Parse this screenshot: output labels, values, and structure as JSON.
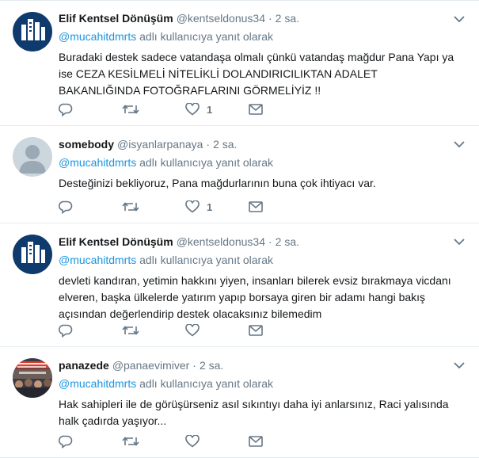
{
  "labels": {
    "reply_suffix": "adlı kullanıcıya yanıt olarak"
  },
  "colors": {
    "link": "#1b95e0",
    "meta": "#657786",
    "icon": "#657786",
    "border": "#e6ecf0"
  },
  "tweets": [
    {
      "name": "Elif Kentsel Dönüşüm",
      "handle": "@kentseldonus34",
      "time": "2 sa.",
      "avatar_icon": "elif-logo-avatar",
      "reply_to": "@mucahitdmrts",
      "text": "Buradaki destek sadece vatandaşa olmalı çünkü vatandaş mağdur Pana Yapı ya ise CEZA KESİLMELİ NİTELİKLİ DOLANDIRICILIKTAN ADALET BAKANLIĞINDA FOTOĞRAFLARINI GÖRMELİYİZ !!",
      "likes": "1"
    },
    {
      "name": "somebody",
      "handle": "@isyanlarpanaya",
      "time": "2 sa.",
      "avatar_icon": "default-user-avatar",
      "reply_to": "@mucahitdmrts",
      "text": "Desteğinizi bekliyoruz, Pana mağdurlarının buna çok ihtiyacı var.",
      "likes": "1"
    },
    {
      "name": "Elif Kentsel Dönüşüm",
      "handle": "@kentseldonus34",
      "time": "2 sa.",
      "avatar_icon": "elif-logo-avatar",
      "reply_to": "@mucahitdmrts",
      "text": "devleti kandıran, yetimin hakkını yiyen, insanları bilerek evsiz bırakmaya vicdanı elveren, başka ülkelerde yatırım yapıp borsaya giren bir adamı hangi bakış açısından değerlendirip destek olacaksınız bilemedim",
      "likes": ""
    },
    {
      "name": "panazede",
      "handle": "@panaevimiver",
      "time": "2 sa.",
      "avatar_icon": "protest-photo-avatar",
      "reply_to": "@mucahitdmrts",
      "text": "Hak sahipleri ile de görüşürseniz asıl sıkıntıyı daha iyi anlarsınız, Raci yalısında halk çadırda yaşıyor...",
      "likes": ""
    }
  ]
}
